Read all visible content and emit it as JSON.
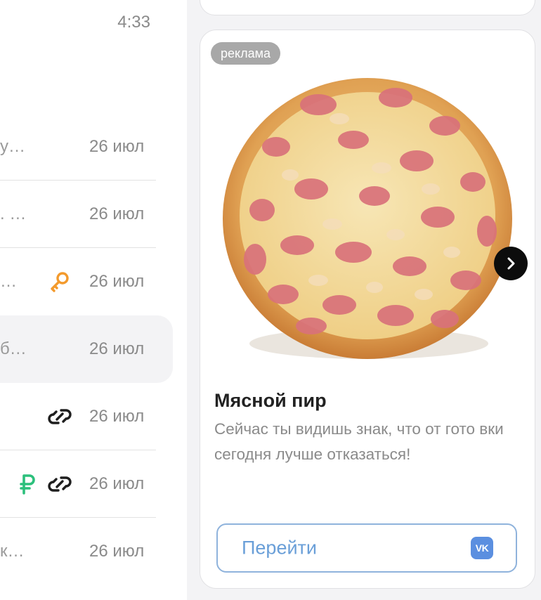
{
  "list": {
    "top_time": "4:33",
    "rows": [
      {
        "snippet": "у…",
        "date": "26 июл"
      },
      {
        "snippet": ". …",
        "date": "26 июл"
      },
      {
        "snippet": "…",
        "date": "26 июл",
        "icons": [
          "key-icon"
        ]
      },
      {
        "snippet": "б…",
        "date": "26 июл",
        "selected": true
      },
      {
        "snippet": "",
        "date": "26 июл",
        "icons": [
          "paperclip-icon"
        ]
      },
      {
        "snippet": "",
        "date": "26 июл",
        "icons": [
          "ruble-icon",
          "paperclip-icon"
        ]
      },
      {
        "snippet": "к…",
        "date": "26 июл"
      }
    ]
  },
  "ad": {
    "badge": "реклама",
    "image": "pizza-image",
    "title": "Мясной пир",
    "text": "Сейчас ты видишь знак, что от гото вки сегодня лучше отказаться!",
    "button_label": "Перейти",
    "button_logo": "VK"
  },
  "colors": {
    "key_icon": "#f39a2c",
    "ruble_icon": "#2cc07c",
    "link_button_border": "#8fb3dc",
    "link_button_text": "#6a9fd8",
    "vk_logo": "#5b8fe0"
  }
}
